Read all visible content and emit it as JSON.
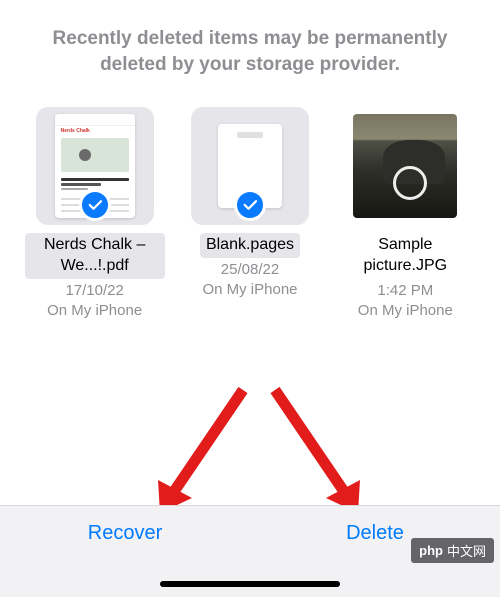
{
  "header": {
    "message": "Recently deleted items may be permanently deleted by your storage provider."
  },
  "files": [
    {
      "name": "Nerds Chalk – We...!.pdf",
      "date": "17/10/22",
      "location": "On My iPhone",
      "selected": true,
      "thumbType": "pdf"
    },
    {
      "name": "Blank.pages",
      "date": "25/08/22",
      "location": "On My iPhone",
      "selected": true,
      "thumbType": "blank"
    },
    {
      "name": "Sample picture.JPG",
      "date": "1:42 PM",
      "location": "On My iPhone",
      "selected": false,
      "thumbType": "photo"
    }
  ],
  "toolbar": {
    "recover": "Recover",
    "delete": "Delete"
  },
  "watermark": {
    "label": "php",
    "text": "中文网"
  }
}
